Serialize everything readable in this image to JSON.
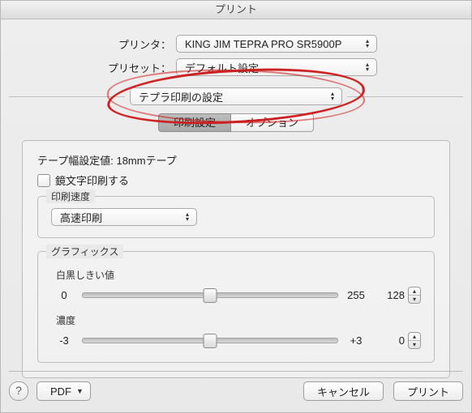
{
  "title": "プリント",
  "rows": {
    "printer_label": "プリンタ：",
    "printer_value": "KING JIM TEPRA PRO SR5900P",
    "preset_label": "プリセット：",
    "preset_value": "デフォルト設定"
  },
  "section_popup": "テプラ印刷の設定",
  "tabs": {
    "print_settings": "印刷設定",
    "options": "オプション"
  },
  "panel": {
    "tape_label": "テープ幅設定値:",
    "tape_value": "18mmテープ",
    "mirror_label": "鏡文字印刷する",
    "speed_group_title": "印刷速度",
    "speed_value": "高速印刷",
    "graphics_group_title": "グラフィックス",
    "threshold": {
      "label": "白黒しきい値",
      "min": "0",
      "max": "255",
      "value": "128"
    },
    "density": {
      "label": "濃度",
      "min": "-3",
      "max": "+3",
      "value": "0"
    }
  },
  "footer": {
    "help": "?",
    "pdf": "PDF",
    "cancel": "キャンセル",
    "print": "プリント"
  }
}
